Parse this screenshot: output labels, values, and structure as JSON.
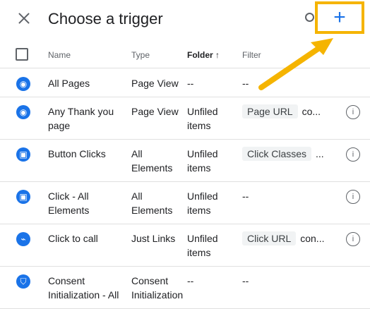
{
  "header": {
    "title": "Choose a trigger",
    "add_label": "+"
  },
  "columns": {
    "name": "Name",
    "type": "Type",
    "folder": "Folder ↑",
    "filter": "Filter"
  },
  "rows": [
    {
      "name": "All Pages",
      "type": "Page View",
      "folder": "--",
      "filter_chip": "",
      "filter_text": "--",
      "icon": "eye-icon",
      "icon_glyph": "◉",
      "info": false
    },
    {
      "name": "Any Thank you page",
      "type": "Page View",
      "folder": "Unfiled items",
      "filter_chip": "Page URL",
      "filter_text": "co...",
      "icon": "eye-icon",
      "icon_glyph": "◉",
      "info": true
    },
    {
      "name": "Button Clicks",
      "type": "All Elements",
      "folder": "Unfiled items",
      "filter_chip": "Click Classes",
      "filter_text": "...",
      "icon": "mouse-icon",
      "icon_glyph": "▣",
      "info": true
    },
    {
      "name": "Click - All Elements",
      "type": "All Elements",
      "folder": "Unfiled items",
      "filter_chip": "",
      "filter_text": "--",
      "icon": "mouse-icon",
      "icon_glyph": "▣",
      "info": true
    },
    {
      "name": "Click to call",
      "type": "Just Links",
      "folder": "Unfiled items",
      "filter_chip": "Click URL",
      "filter_text": "con...",
      "icon": "link-icon",
      "icon_glyph": "⌁",
      "info": true
    },
    {
      "name": "Consent Initialization - All",
      "type": "Consent Initialization",
      "folder": "--",
      "filter_chip": "",
      "filter_text": "--",
      "icon": "shield-icon",
      "icon_glyph": "⛉",
      "info": false
    }
  ],
  "info_glyph": "i",
  "colors": {
    "accent": "#1a73e8",
    "highlight": "#f5b400"
  }
}
